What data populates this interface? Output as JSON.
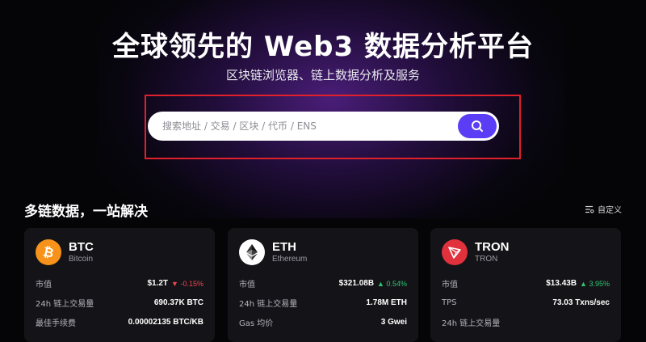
{
  "hero": {
    "title": "全球领先的 Web3 数据分析平台",
    "subtitle": "区块链浏览器、链上数据分析及服务"
  },
  "search": {
    "placeholder": "搜索地址 / 交易 / 区块 / 代币 / ENS",
    "value": "",
    "button_icon": "search-icon"
  },
  "section": {
    "title": "多链数据，一站解决",
    "customize_label": "自定义",
    "customize_icon": "list-settings-icon"
  },
  "colors": {
    "accent": "#5b3df5",
    "highlight_frame": "#e0202a",
    "btc": "#f7931a",
    "tron": "#e0313d",
    "down": "#f0454d",
    "up": "#2ec56f"
  },
  "cards": [
    {
      "symbol": "BTC",
      "name": "Bitcoin",
      "icon": "bitcoin-icon",
      "rows": [
        {
          "label": "市值",
          "value": "$1.2T",
          "change": "-0.15%",
          "direction": "down"
        },
        {
          "label": "24h 链上交易量",
          "value": "690.37K BTC"
        },
        {
          "label": "最佳手续费",
          "value": "0.00002135 BTC/KB"
        }
      ]
    },
    {
      "symbol": "ETH",
      "name": "Ethereum",
      "icon": "ethereum-icon",
      "rows": [
        {
          "label": "市值",
          "value": "$321.08B",
          "change": "0.54%",
          "direction": "up"
        },
        {
          "label": "24h 链上交易量",
          "value": "1.78M ETH"
        },
        {
          "label": "Gas 均价",
          "value": "3 Gwei"
        }
      ]
    },
    {
      "symbol": "TRON",
      "name": "TRON",
      "icon": "tron-icon",
      "rows": [
        {
          "label": "市值",
          "value": "$13.43B",
          "change": "3.95%",
          "direction": "up"
        },
        {
          "label": "TPS",
          "value": "73.03 Txns/sec"
        },
        {
          "label": "24h 链上交易量",
          "value": ""
        }
      ]
    }
  ]
}
